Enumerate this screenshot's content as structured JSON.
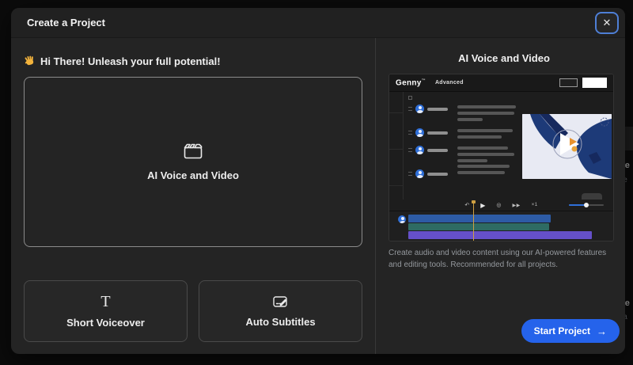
{
  "background": {
    "fragments": [
      {
        "text": "tle"
      },
      {
        "text": "ie"
      },
      {
        "text": "tle"
      },
      {
        "text": "ia"
      }
    ]
  },
  "modal": {
    "title": "Create a Project",
    "close_icon": "✕",
    "left": {
      "greeting": "Hi There! Unleash your full potential!",
      "greeting_icon": "👋",
      "primary_card": {
        "label": "AI Voice and Video",
        "icon": "clapperboard-icon"
      },
      "secondary_cards": [
        {
          "label": "Short Voiceover",
          "icon": "text-T-icon",
          "glyph": "T"
        },
        {
          "label": "Auto Subtitles",
          "icon": "subtitles-edit-icon"
        }
      ]
    },
    "right": {
      "title": "AI Voice and Video",
      "preview": {
        "app_name": "Genny",
        "app_mark": "™",
        "mode_label": "Advanced",
        "toolbar": {
          "undo_icon": "↶",
          "play_icon": "▶",
          "record_icon": "◎",
          "skip_icon": "▶▶",
          "speed_label": "×1"
        }
      },
      "description": "Create audio and video content using our AI-powered features and editing tools. Recommended for all projects.",
      "start_button": {
        "label": "Start Project",
        "arrow": "→"
      }
    }
  },
  "colors": {
    "accent_blue": "#2563eb",
    "close_ring_blue": "#4e7fd6",
    "avatar_blue": "#2f6fd8",
    "track_blue": "#2d5ba5",
    "track_teal": "#2e6b63",
    "track_purple": "#6550c9",
    "playhead_yellow": "#cfa042",
    "video_navy": "#1d3a78",
    "video_bg": "#e8eaf3"
  }
}
